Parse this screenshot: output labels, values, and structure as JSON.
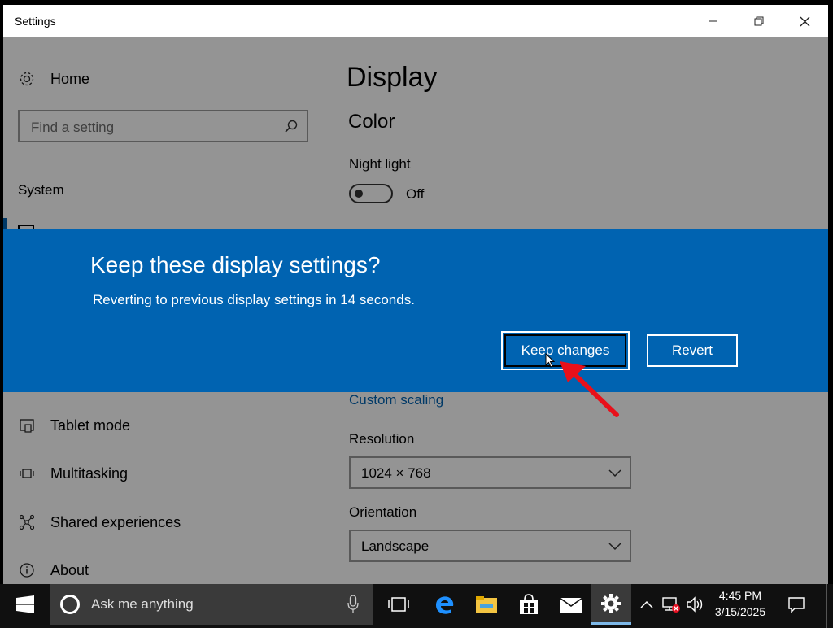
{
  "window": {
    "title": "Settings",
    "minimize": "—",
    "maximize": "❐",
    "close": "✕"
  },
  "sidebar": {
    "home_label": "Home",
    "search_placeholder": "Find a setting",
    "section_label": "System",
    "items": [
      {
        "label": "Tablet mode",
        "icon": "tablet-mode-icon"
      },
      {
        "label": "Multitasking",
        "icon": "multitasking-icon"
      },
      {
        "label": "Shared experiences",
        "icon": "shared-experiences-icon"
      },
      {
        "label": "About",
        "icon": "info-icon"
      }
    ]
  },
  "main": {
    "page_title": "Display",
    "color_heading": "Color",
    "night_light_label": "Night light",
    "night_light_state": "Off",
    "custom_scaling_link": "Custom scaling",
    "resolution_label": "Resolution",
    "resolution_value": "1024 × 768",
    "orientation_label": "Orientation",
    "orientation_value": "Landscape"
  },
  "dialog": {
    "title": "Keep these display settings?",
    "message": "Reverting to previous display settings in 14 seconds.",
    "keep_label": "Keep changes",
    "revert_label": "Revert",
    "background_color": "#0063b1"
  },
  "taskbar": {
    "search_text": "Ask me anything",
    "time": "4:45 PM",
    "date": "3/15/2025",
    "active_app": "settings"
  },
  "colors": {
    "accent": "#0063b1",
    "annotation_arrow": "#e8101a"
  }
}
